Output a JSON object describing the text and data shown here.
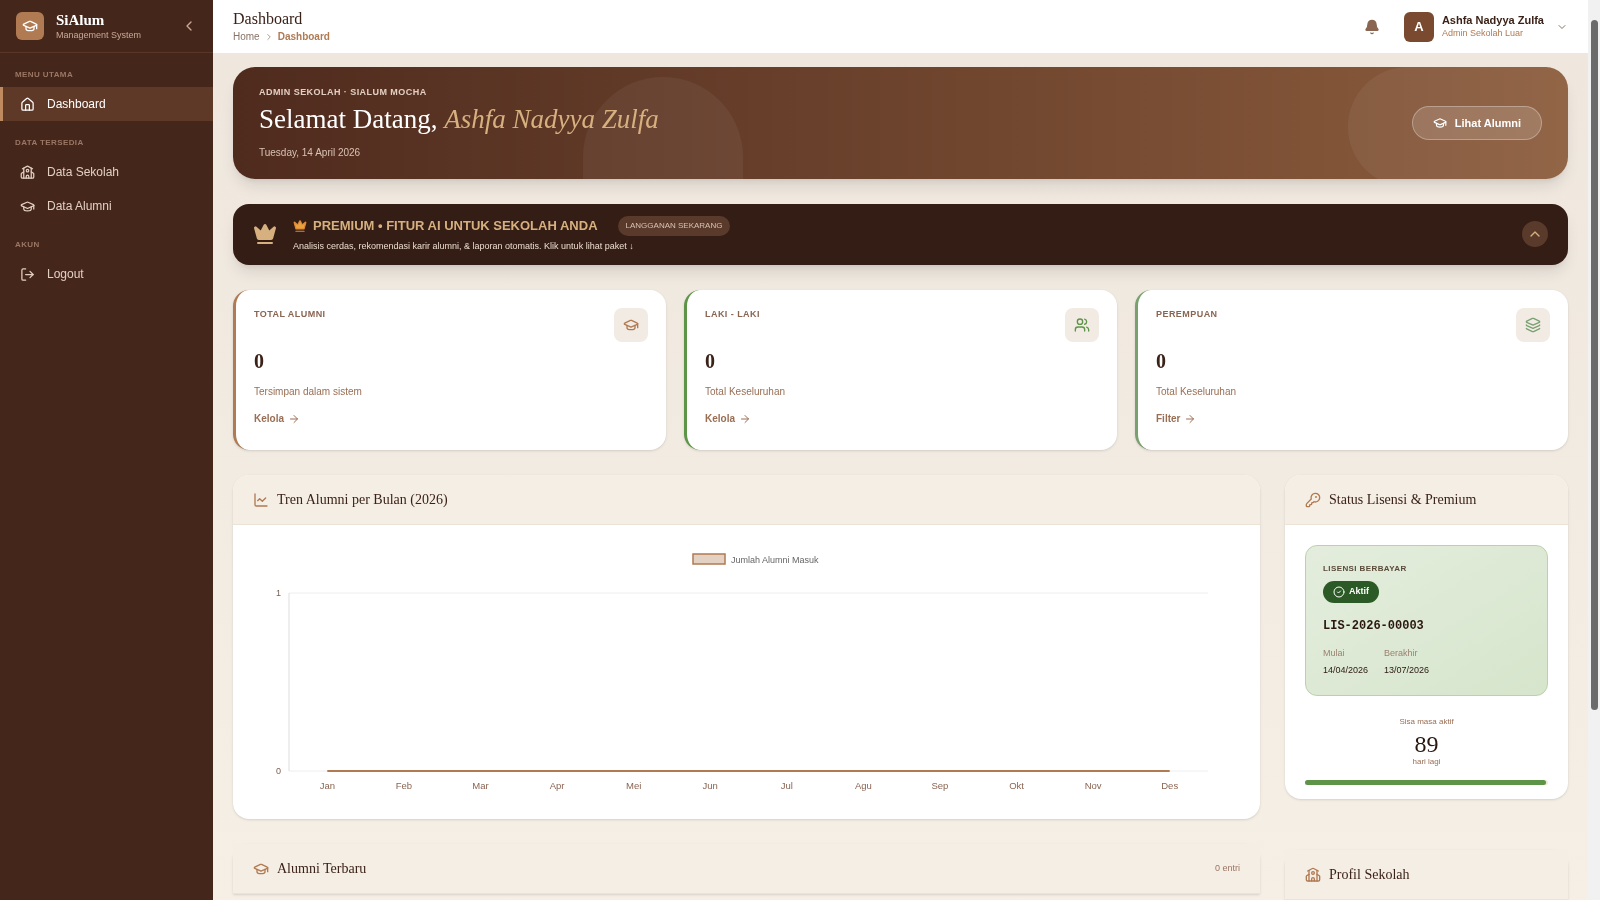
{
  "sidebar": {
    "brand": "SiAlum",
    "subtitle": "Management System",
    "sections": [
      {
        "title": "MENU UTAMA",
        "items": [
          {
            "label": "Dashboard",
            "selected": true
          }
        ]
      },
      {
        "title": "DATA TERSEDIA",
        "items": [
          {
            "label": "Data Sekolah",
            "selected": false
          },
          {
            "label": "Data Alumni",
            "selected": false
          }
        ]
      },
      {
        "title": "AKUN",
        "items": [
          {
            "label": "Logout",
            "selected": false
          }
        ]
      }
    ]
  },
  "header": {
    "title": "Dashboard",
    "breadcrumb": [
      {
        "label": "Home",
        "selected": false
      },
      {
        "label": "Dashboard",
        "selected": true
      }
    ],
    "user": {
      "initial": "A",
      "name": "Ashfa Nadyya Zulfa",
      "role": "Admin Sekolah Luar"
    }
  },
  "hero": {
    "eyebrow": "ADMIN SEKOLAH · SIALUM MOCHA",
    "greeting": "Selamat Datang,",
    "name": "Ashfa Nadyya Zulfa",
    "date": "Tuesday, 14 April 2026",
    "button": "Lihat Alumni"
  },
  "premium": {
    "title": "PREMIUM • FITUR AI UNTUK SEKOLAH ANDA",
    "badge": "LANGGANAN SEKARANG",
    "description": "Analisis cerdas, rekomendasi karir alumni, & laporan otomatis. Klik untuk lihat paket ↓",
    "expanded": false
  },
  "stats": [
    {
      "label": "TOTAL ALUMNI",
      "value": "0",
      "caption": "Tersimpan dalam sistem",
      "link": "Kelola",
      "color": "#b07a52"
    },
    {
      "label": "LAKI - LAKI",
      "value": "0",
      "caption": "Total Keseluruhan",
      "link": "Kelola",
      "color": "#5e9448"
    },
    {
      "label": "PEREMPUAN",
      "value": "0",
      "caption": "Total Keseluruhan",
      "link": "Filter",
      "color": "#7aa070"
    }
  ],
  "trend": {
    "title": "Tren Alumni per Bulan (2026)",
    "chart_data": {
      "type": "line",
      "categories": [
        "Jan",
        "Feb",
        "Mar",
        "Apr",
        "Mei",
        "Jun",
        "Jul",
        "Agu",
        "Sep",
        "Okt",
        "Nov",
        "Des"
      ],
      "series": [
        {
          "name": "Jumlah Alumni Masuk",
          "color": "#b07a52",
          "values": [
            0,
            0,
            0,
            0,
            0,
            0,
            0,
            0,
            0,
            0,
            0,
            0
          ]
        }
      ],
      "ylim": [
        0,
        1
      ],
      "yticks": [
        0,
        1
      ]
    }
  },
  "license": {
    "title": "Status Lisensi & Premium",
    "type": "LISENSI BERBAYAR",
    "status": "Aktif",
    "code": "LIS-2026-00003",
    "start_label": "Mulai",
    "start": "14/04/2026",
    "end_label": "Berakhir",
    "end": "13/07/2026",
    "remaining_label": "Sisa masa aktif",
    "remaining": "89",
    "remaining_unit": "hari lagi",
    "level": 0.99
  },
  "recent": {
    "title": "Alumni Terbaru",
    "count": "0 entri"
  },
  "profile": {
    "title": "Profil Sekolah"
  }
}
